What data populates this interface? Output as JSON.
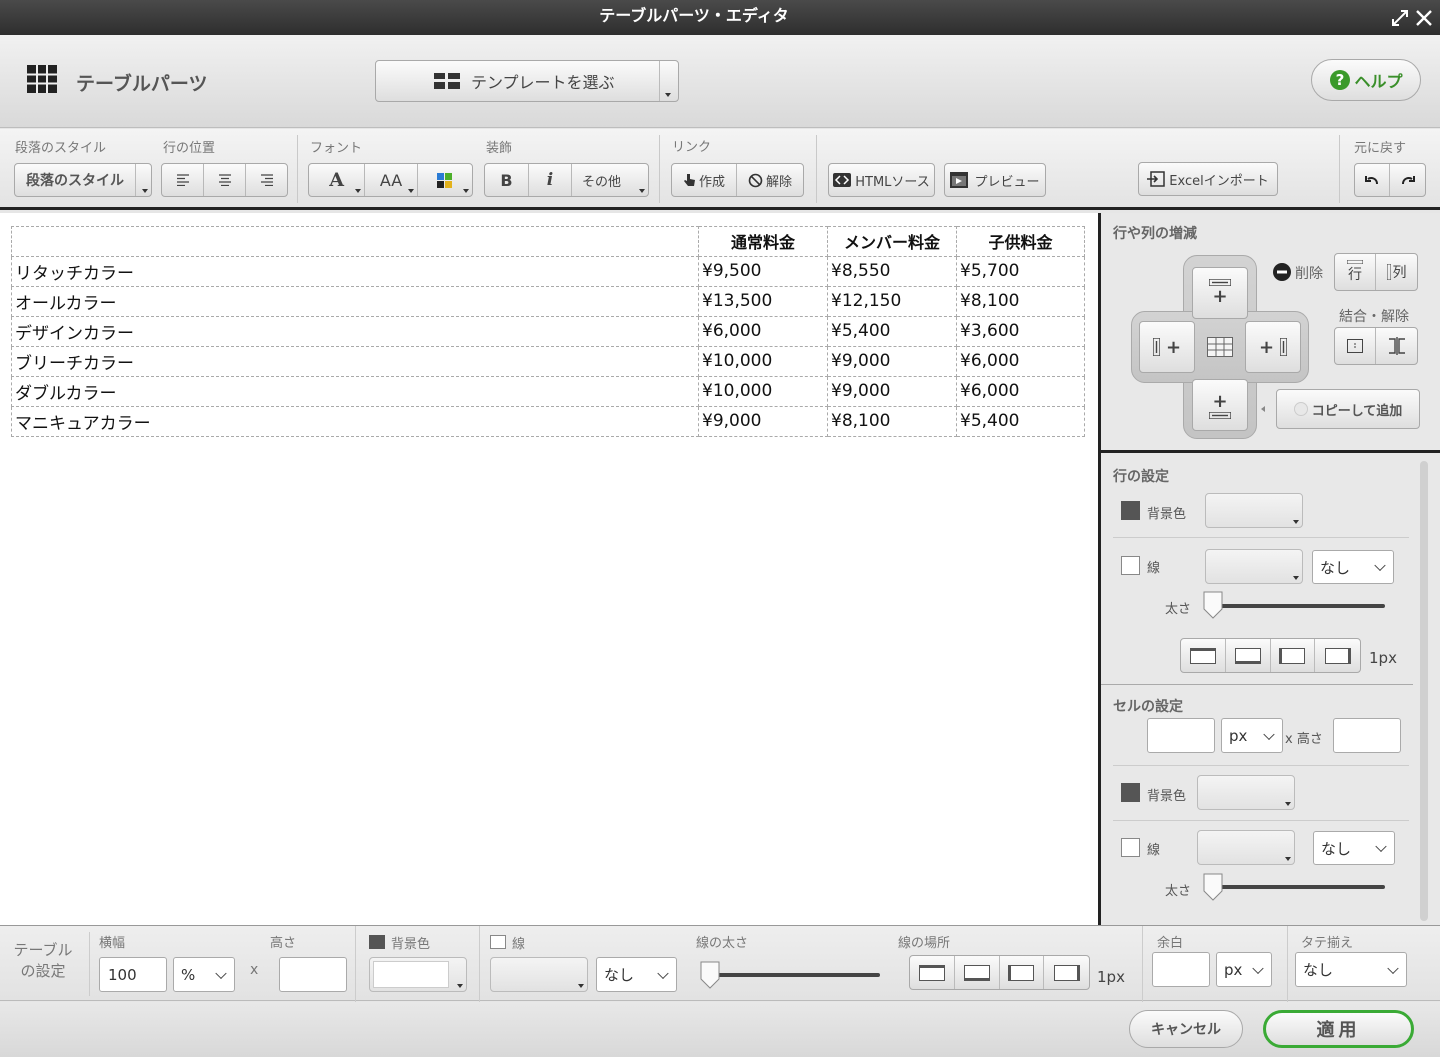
{
  "window": {
    "title": "テーブルパーツ・エディタ"
  },
  "header": {
    "app_name": "テーブルパーツ",
    "template_button": "テンプレートを選ぶ",
    "help_button": "ヘルプ"
  },
  "toolbar": {
    "groups": {
      "paragraph_style": "段落のスタイル",
      "row_position": "行の位置",
      "font": "フォント",
      "decoration": "装飾",
      "link": "リンク",
      "undo": "元に戻す"
    },
    "paragraph_style_button": "段落のスタイル",
    "font_buttons": {
      "font": "A",
      "size": "AA"
    },
    "bold": "B",
    "italic": "i",
    "other": "その他",
    "link_create": "作成",
    "link_remove": "解除",
    "html_source": "HTMLソース",
    "preview": "プレビュー",
    "excel_import": "Excelインポート"
  },
  "table": {
    "headers": [
      "",
      "通常料金",
      "メンバー料金",
      "子供料金"
    ],
    "rows": [
      [
        "リタッチカラー",
        "¥9,500",
        "¥8,550",
        "¥5,700"
      ],
      [
        "オールカラー",
        "¥13,500",
        "¥12,150",
        "¥8,100"
      ],
      [
        "デザインカラー",
        "¥6,000",
        "¥5,400",
        "¥3,600"
      ],
      [
        "ブリーチカラー",
        "¥10,000",
        "¥9,000",
        "¥6,000"
      ],
      [
        "ダブルカラー",
        "¥10,000",
        "¥9,000",
        "¥6,000"
      ],
      [
        "マニキュアカラー",
        "¥9,000",
        "¥8,100",
        "¥5,400"
      ]
    ]
  },
  "side_panel": {
    "row_col_title": "行や列の増減",
    "delete_label": "削除",
    "delete_row": "行",
    "delete_col": "列",
    "merge_label": "結合・解除",
    "copy_add": "コピーして追加",
    "row_settings": {
      "title": "行の設定",
      "bg_color": "背景色",
      "border": "線",
      "border_style": "なし",
      "thickness": "太さ",
      "thickness_value": "1px"
    },
    "cell_settings": {
      "title": "セルの設定",
      "width_unit": "px",
      "height_label": "x 高さ",
      "bg_color": "背景色",
      "border": "線",
      "border_style": "なし",
      "thickness": "太さ"
    }
  },
  "bottom_bar": {
    "title_line1": "テーブル",
    "title_line2": "の設定",
    "width_label": "横幅",
    "width_value": "100",
    "width_unit": "%",
    "x_sep": "x",
    "height_label": "高さ",
    "bg_color": "背景色",
    "border": "線",
    "border_style": "なし",
    "border_thickness": "線の太さ",
    "border_position": "線の場所",
    "border_px": "1px",
    "margin_label": "余白",
    "margin_unit": "px",
    "valign_label": "タテ揃え",
    "valign_value": "なし"
  },
  "footer": {
    "cancel": "キャンセル",
    "apply": "適用"
  }
}
